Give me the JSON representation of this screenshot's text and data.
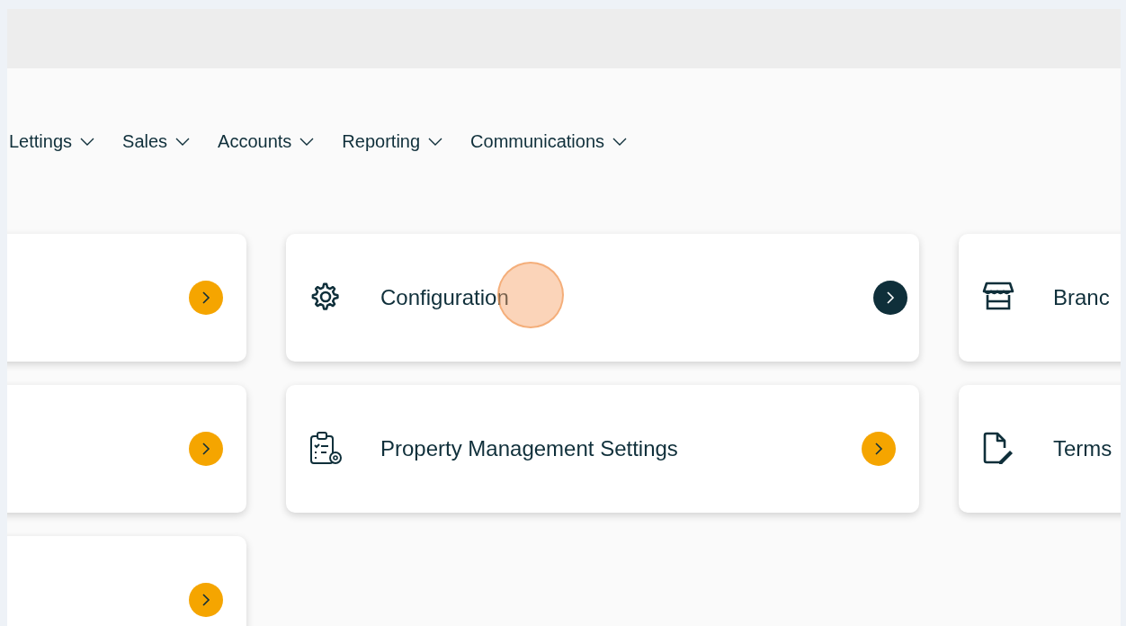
{
  "nav": [
    {
      "label": "Lettings"
    },
    {
      "label": "Sales"
    },
    {
      "label": "Accounts"
    },
    {
      "label": "Reporting"
    },
    {
      "label": "Communications"
    }
  ],
  "columns": [
    {
      "cards": [
        {
          "active": false
        },
        {
          "active": false
        },
        {
          "active": false
        }
      ]
    },
    {
      "cards": [
        {
          "kind": "gear",
          "label": "Configuration",
          "active": true,
          "cursor_highlight": true
        },
        {
          "kind": "clipboard-gear",
          "label": "Property Management Settings",
          "active": false
        }
      ]
    },
    {
      "cards": [
        {
          "kind": "store",
          "label": "Branc"
        },
        {
          "kind": "document-pen",
          "label": "Terms"
        }
      ]
    }
  ]
}
